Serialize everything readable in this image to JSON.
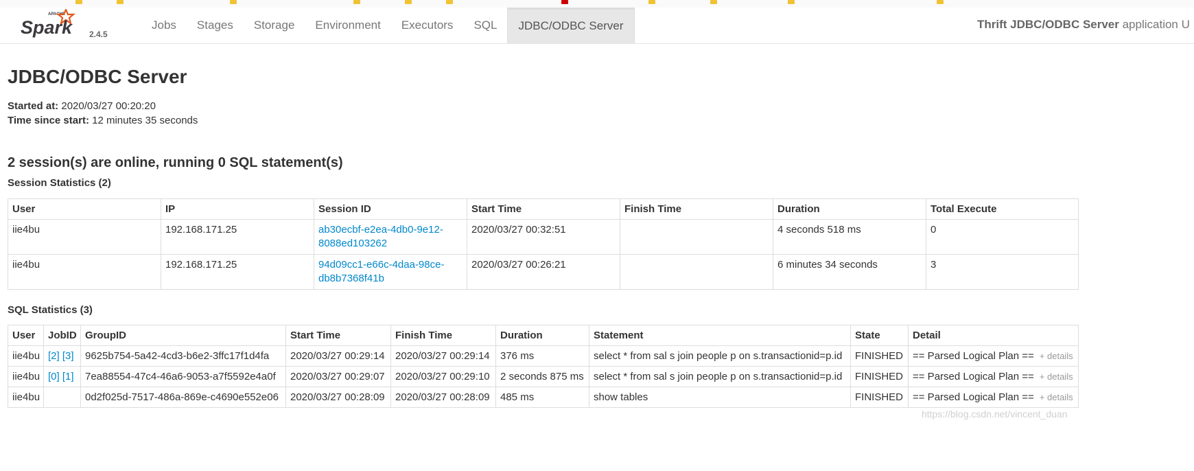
{
  "navbar": {
    "logo_apache": "APACHE",
    "logo_text": "Spark",
    "version": "2.4.5",
    "tabs": [
      {
        "label": "Jobs"
      },
      {
        "label": "Stages"
      },
      {
        "label": "Storage"
      },
      {
        "label": "Environment"
      },
      {
        "label": "Executors"
      },
      {
        "label": "SQL"
      },
      {
        "label": "JDBC/ODBC Server",
        "active": true
      }
    ],
    "app_name_bold": "Thrift JDBC/ODBC Server",
    "app_name_rest": " application U"
  },
  "page": {
    "title": "JDBC/ODBC Server",
    "started_at_label": "Started at:",
    "started_at_value": " 2020/03/27 00:20:20",
    "time_since_label": "Time since start:",
    "time_since_value": " 12 minutes 35 seconds",
    "summary": "2 session(s) are online, running 0 SQL statement(s)"
  },
  "session_stats": {
    "heading": "Session Statistics (2)",
    "columns": [
      "User",
      "IP",
      "Session ID",
      "Start Time",
      "Finish Time",
      "Duration",
      "Total Execute"
    ],
    "rows": [
      {
        "user": "iie4bu",
        "ip": "192.168.171.25",
        "session_id_1": "ab30ecbf-e2ea-4db0-9e12-",
        "session_id_2": "8088ed103262",
        "start": "2020/03/27 00:32:51",
        "finish": "",
        "duration": "4 seconds 518 ms",
        "total": "0"
      },
      {
        "user": "iie4bu",
        "ip": "192.168.171.25",
        "session_id_1": "94d09cc1-e66c-4daa-98ce-",
        "session_id_2": "db8b7368f41b",
        "start": "2020/03/27 00:26:21",
        "finish": "",
        "duration": "6 minutes 34 seconds",
        "total": "3"
      }
    ]
  },
  "sql_stats": {
    "heading": "SQL Statistics (3)",
    "columns": [
      "User",
      "JobID",
      "GroupID",
      "Start Time",
      "Finish Time",
      "Duration",
      "Statement",
      "State",
      "Detail"
    ],
    "rows": [
      {
        "user": "iie4bu",
        "job_a": "[2]",
        "job_b": "[3]",
        "group": "9625b754-5a42-4cd3-b6e2-3ffc17f1d4fa",
        "start": "2020/03/27 00:29:14",
        "finish": "2020/03/27 00:29:14",
        "duration": "376 ms",
        "statement": "select * from sal s join people p on s.transactionid=p.id",
        "state": "FINISHED",
        "detail": "== Parsed Logical Plan ==",
        "details_link": "+ details"
      },
      {
        "user": "iie4bu",
        "job_a": "[0]",
        "job_b": "[1]",
        "group": "7ea88554-47c4-46a6-9053-a7f5592e4a0f",
        "start": "2020/03/27 00:29:07",
        "finish": "2020/03/27 00:29:10",
        "duration": "2 seconds 875 ms",
        "statement": "select * from sal s join people p on s.transactionid=p.id",
        "state": "FINISHED",
        "detail": "== Parsed Logical Plan ==",
        "details_link": "+ details"
      },
      {
        "user": "iie4bu",
        "job_a": "",
        "job_b": "",
        "group": "0d2f025d-7517-486a-869e-c4690e552e06",
        "start": "2020/03/27 00:28:09",
        "finish": "2020/03/27 00:28:09",
        "duration": "485 ms",
        "statement": "show tables",
        "state": "FINISHED",
        "detail": "== Parsed Logical Plan ==",
        "details_link": "+ details"
      }
    ]
  },
  "watermark": "https://blog.csdn.net/vincent_duan",
  "colors": {
    "link": "#0088cc",
    "logo_orange": "#e25a1c",
    "logo_text": "#3c3a3e"
  }
}
